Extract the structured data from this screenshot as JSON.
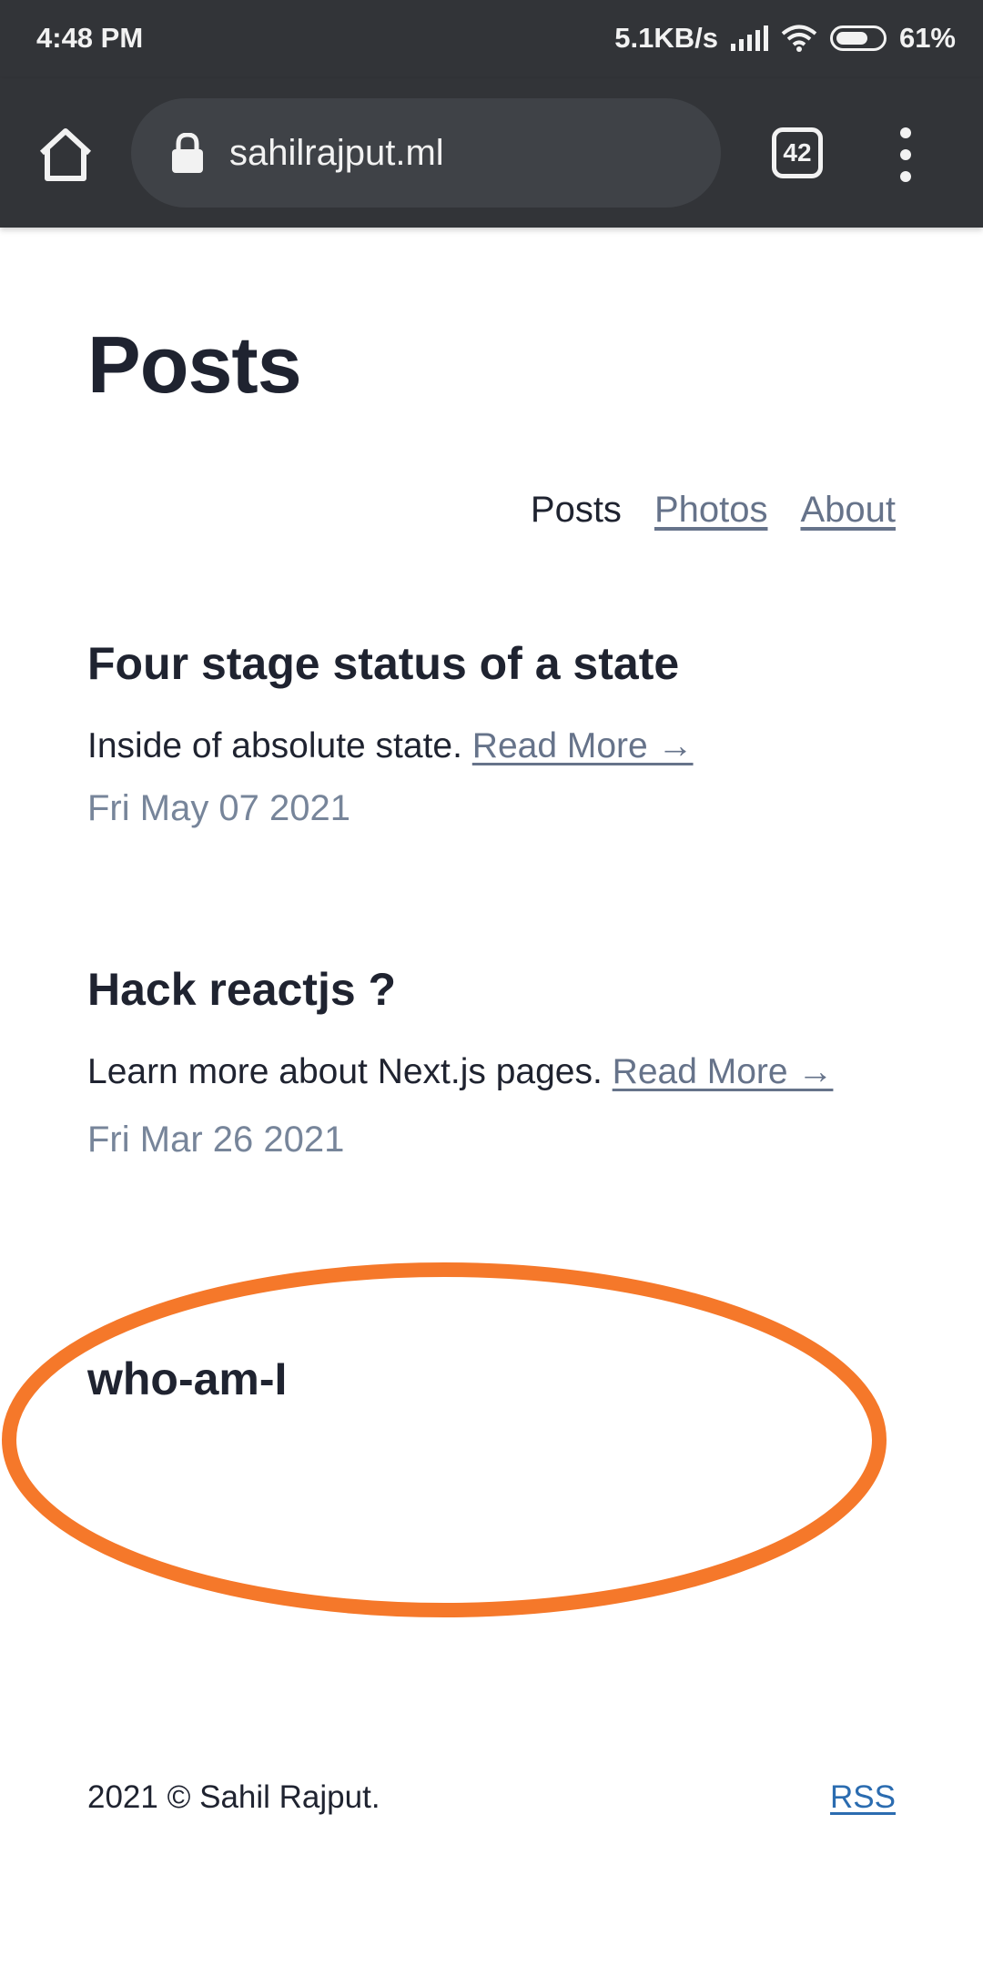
{
  "status_bar": {
    "time": "4:48 PM",
    "net_speed": "5.1KB/s",
    "battery": "61%",
    "battery_level": 0.61
  },
  "browser": {
    "url": "sahilrajput.ml",
    "tab_count": "42"
  },
  "page": {
    "title": "Posts",
    "nav": {
      "posts": "Posts",
      "photos": "Photos",
      "about": "About"
    },
    "posts": [
      {
        "title": "Four stage status of a state",
        "summary": "Inside of absolute state.",
        "read_more": "Read More →",
        "date": "Fri May 07 2021"
      },
      {
        "title": "Hack reactjs ?",
        "summary": "Learn more about Next.js pages.",
        "read_more": "Read More →",
        "date": "Fri Mar 26 2021"
      },
      {
        "title": "who-am-I"
      }
    ],
    "footer": {
      "copyright": "2021 © Sahil Rajput.",
      "rss": "RSS"
    }
  },
  "colors": {
    "chrome_bg": "#323438",
    "url_bg": "#3f4247",
    "text": "#1f2330",
    "muted": "#66738a",
    "link": "#2b6cb0",
    "annotation": "#f5782a"
  }
}
